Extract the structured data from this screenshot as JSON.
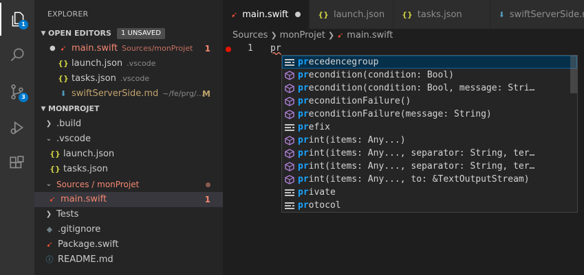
{
  "activity": {
    "explorer_badge": "1",
    "scm_badge": "3"
  },
  "sidebar": {
    "title": "EXPLORER",
    "open_editors": {
      "header": "OPEN EDITORS",
      "unsaved": "1 UNSAVED",
      "items": [
        {
          "name": "main.swift",
          "path": "Sources/monProjet",
          "badge": "1",
          "icon": "swift-icon"
        },
        {
          "name": "launch.json",
          "path": ".vscode",
          "icon": "json-icon"
        },
        {
          "name": "tasks.json",
          "path": ".vscode",
          "icon": "json-icon"
        },
        {
          "name": "swiftServerSide.md",
          "path": "~/fe/prg/...",
          "badge": "M",
          "icon": "markdown-icon"
        }
      ]
    },
    "project": {
      "header": "MONPROJET",
      "items": [
        {
          "label": ".build"
        },
        {
          "label": ".vscode"
        },
        {
          "label": "launch.json"
        },
        {
          "label": "tasks.json"
        },
        {
          "label": "Sources / monProjet"
        },
        {
          "label": "main.swift",
          "badge": "1"
        },
        {
          "label": "Tests"
        },
        {
          "label": ".gitignore"
        },
        {
          "label": "Package.swift"
        },
        {
          "label": "README.md"
        }
      ]
    }
  },
  "tabs": [
    {
      "label": "main.swift",
      "icon": "swift-icon"
    },
    {
      "label": "launch.json",
      "icon": "json-icon"
    },
    {
      "label": "tasks.json",
      "icon": "json-icon"
    },
    {
      "label": "swiftServerSide.md",
      "icon": "markdown-icon"
    }
  ],
  "breadcrumb": [
    "Sources",
    "monProjet",
    "main.swift"
  ],
  "editor": {
    "line_number": "1",
    "code": "pr"
  },
  "suggestions": [
    {
      "match": "pr",
      "rest": "ecedencegroup",
      "kind": "keyword"
    },
    {
      "match": "pr",
      "rest": "econdition(condition: Bool)",
      "kind": "method"
    },
    {
      "match": "pr",
      "rest": "econdition(condition: Bool, message: Stri…",
      "kind": "method"
    },
    {
      "match": "pr",
      "rest": "econditionFailure()",
      "kind": "method"
    },
    {
      "match": "pr",
      "rest": "econditionFailure(message: String)",
      "kind": "method"
    },
    {
      "match": "pr",
      "rest": "efix",
      "kind": "keyword"
    },
    {
      "match": "pr",
      "rest": "int(items: Any...)",
      "kind": "method"
    },
    {
      "match": "pr",
      "rest": "int(items: Any..., separator: String, ter…",
      "kind": "method"
    },
    {
      "match": "pr",
      "rest": "int(items: Any..., separator: String, ter…",
      "kind": "method"
    },
    {
      "match": "pr",
      "rest": "int(items: Any..., to: &TextOutputStream)",
      "kind": "method"
    },
    {
      "match": "pr",
      "rest": "ivate",
      "kind": "keyword"
    },
    {
      "match": "pr",
      "rest": "otocol",
      "kind": "keyword"
    }
  ],
  "colors": {
    "accent": "#007acc",
    "error": "#f48771",
    "match": "#18a3ff"
  }
}
